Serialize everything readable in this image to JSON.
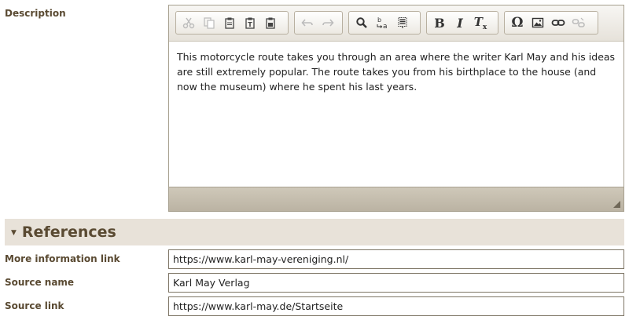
{
  "description": {
    "label": "Description",
    "toolbar": {
      "groups": [
        [
          {
            "name": "cut-icon",
            "glyph": "✂",
            "enabled": false
          },
          {
            "name": "copy-icon",
            "glyph": "❐",
            "enabled": false
          },
          {
            "name": "paste-icon",
            "glyph": "📋",
            "enabled": true
          },
          {
            "name": "paste-text-icon",
            "glyph": "T",
            "enabled": true
          },
          {
            "name": "paste-from-word-icon",
            "glyph": "W",
            "enabled": true
          }
        ],
        [
          {
            "name": "undo-icon",
            "glyph": "↶",
            "enabled": false
          },
          {
            "name": "redo-icon",
            "glyph": "↷",
            "enabled": false
          }
        ],
        [
          {
            "name": "find-icon",
            "glyph": "🔍",
            "enabled": true
          },
          {
            "name": "replace-icon",
            "glyph": "b→a",
            "enabled": true
          },
          {
            "name": "select-all-icon",
            "glyph": "☰",
            "enabled": true
          }
        ],
        [
          {
            "name": "bold-icon",
            "glyph": "B",
            "enabled": true
          },
          {
            "name": "italic-icon",
            "glyph": "I",
            "enabled": true
          },
          {
            "name": "remove-format-icon",
            "glyph": "Tx",
            "enabled": true
          }
        ],
        [
          {
            "name": "special-character-icon",
            "glyph": "Ω",
            "enabled": true
          },
          {
            "name": "image-icon",
            "glyph": "▣",
            "enabled": true
          },
          {
            "name": "link-icon",
            "glyph": "🔗",
            "enabled": true
          },
          {
            "name": "unlink-icon",
            "glyph": "⛓",
            "enabled": false
          }
        ]
      ]
    },
    "content": "This motorcycle route takes you through an area where the writer Karl May and his ideas are still extremely popular. The route takes you from his birthplace to the house (and now the museum) where he spent his last years."
  },
  "references": {
    "section_title": "References",
    "more_info_link": {
      "label": "More information link",
      "value": "https://www.karl-may-vereniging.nl/"
    },
    "source_name": {
      "label": "Source name",
      "value": "Karl May Verlag"
    },
    "source_link": {
      "label": "Source link",
      "value": "https://www.karl-may.de/Startseite"
    }
  },
  "colors": {
    "label_text": "#5a4a32",
    "section_bg": "#e8e2d9",
    "statusbar": "#c4bcac"
  }
}
